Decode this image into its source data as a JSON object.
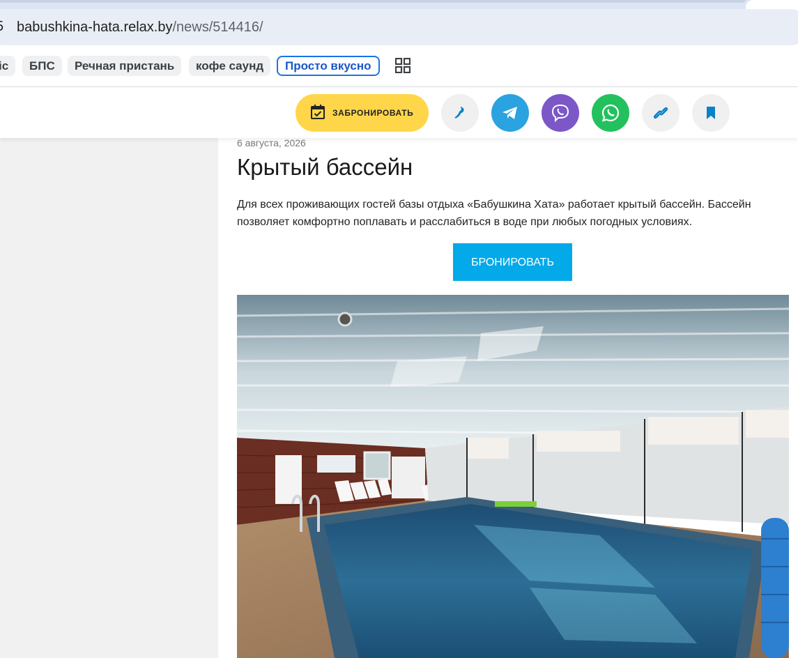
{
  "browser": {
    "url_host": "babushkina-hata.relax.by",
    "url_path": "/news/514416/",
    "site_icon_glyph": "5",
    "bookmarks": [
      {
        "label": "іс"
      },
      {
        "label": "БПС"
      },
      {
        "label": "Речная пристань"
      },
      {
        "label": "кофе саунд"
      },
      {
        "label": "Просто вкусно",
        "active": true
      }
    ]
  },
  "header": {
    "book_label": "ЗАБРОНИРОВАТЬ",
    "buttons": [
      {
        "name": "phone-icon",
        "color": "#f0f0f0"
      },
      {
        "name": "telegram-icon",
        "color": "#2aa3e0"
      },
      {
        "name": "viber-icon",
        "color": "#7b57c8"
      },
      {
        "name": "whatsapp-icon",
        "color": "#22c15e"
      },
      {
        "name": "link-icon",
        "color": "#f0f0f0"
      },
      {
        "name": "bookmark-icon",
        "color": "#f0f0f0"
      }
    ],
    "accent": "#03a9e8",
    "book_color": "#ffd64a"
  },
  "article": {
    "date": "6 августа, 2026",
    "title": "Крытый бассейн",
    "text": "Для всех проживающих гостей базы отдыха «Бабушкина Хата» работает крытый бассейн. Бассейн позволяет комфортно поплавать и расслабиться в воде при любых погодных условиях.",
    "cta": "БРОНИРОВАТЬ"
  }
}
